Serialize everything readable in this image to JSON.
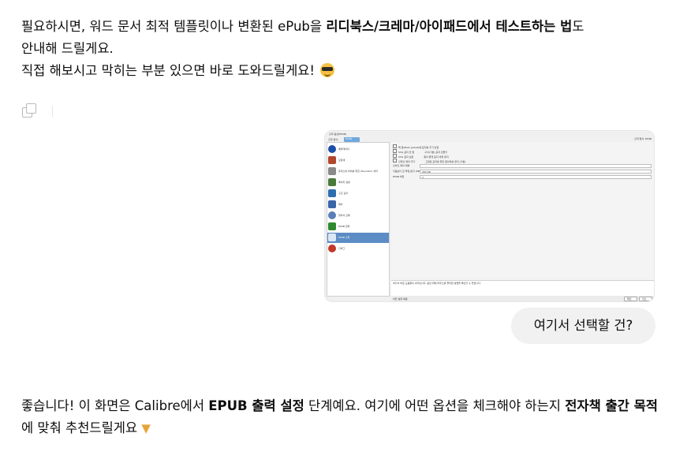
{
  "assistant_message_1": {
    "seg1": "필요하시면, 워드 문서 최적 템플릿이나 변환된 ePub을 ",
    "seg2_bold": "리디북스/크레마/아이패드에서 테스트하는 법",
    "seg3": "도",
    "line2": "안내해 드릴게요.",
    "line3": "직접 해보시고 막히는 부분 있으면 바로 도와드릴게요! ",
    "emoji": "smiling-face-with-sunglasses"
  },
  "actions": {
    "copy_icon": "copy-icon"
  },
  "user_message": {
    "image": {
      "window_title": "출력 옵션(EPUB)",
      "tabs": [
        "출력 형식:",
        "EPUB"
      ],
      "format_label": "출력 형식: EPUB",
      "sidebar_items": [
        {
          "label": "메타데이터",
          "icon": "info-icon",
          "color": "#1b4fa8"
        },
        {
          "label": "모양새",
          "icon": "brush-icon",
          "color": "#b3472b"
        },
        {
          "label": "휴리스틱 처리를 위한 (Heuristic) 처리",
          "icon": "document-icon",
          "color": "#6d6d6d"
        },
        {
          "label": "페이지 설정",
          "icon": "tools-icon",
          "color": "#4a7a3a"
        },
        {
          "label": "구조 감지",
          "icon": "list-icon",
          "color": "#2f6fb0"
        },
        {
          "label": "목차",
          "icon": "toc-icon",
          "color": "#3a66a8"
        },
        {
          "label": "찾아서 교체",
          "icon": "magnifier-icon",
          "color": "#5a7fb5"
        },
        {
          "label": "EPUB 입력",
          "icon": "arrow-right-icon",
          "color": "#2f8a2f"
        },
        {
          "label": "EPUB 출력",
          "icon": "epub-icon",
          "color": "#5b8cc5"
        },
        {
          "label": "디버그",
          "icon": "bug-icon",
          "color": "#c0392b"
        }
      ],
      "options": [
        "책 앞(Book Jacket)에 표지를 추가 안함",
        "SVG 표지 안 함",
        "SVG 표지 보존",
        "인라인 목차 추가"
      ],
      "option_hints": [
        "구식(기본) 표지 만들기",
        "종이 형태 표지 비율 유지",
        "목차 마지막에 추가",
        "고정된 표지를 위한 종횡비를 유지 (기본)"
      ],
      "fields": [
        {
          "label": "인라인 목차 제목",
          "value": ""
        },
        {
          "label": "다음보다 큰 파일 분할 (KB)",
          "value": "260 KB"
        },
        {
          "label": "EPUB 버전",
          "value": "2"
        }
      ],
      "description": "여기서 바로 도움말이 나타납니다. 옵션 위에 마우스를 올리면 설명을 확인할 수 있습니다.",
      "footer_left": "이전 설정 복원",
      "ok_label": "확인",
      "cancel_label": "취소"
    },
    "text": "여기서 선택할 건?"
  },
  "assistant_message_2": {
    "seg1": "좋습니다! 이 화면은 Calibre에서 ",
    "seg2_bold": "EPUB 출력 설정",
    "seg3": " 단계예요. 여기에 어떤 옵션을 체크해야 하는지 ",
    "seg4_bold": "전자책 출간 목적",
    "seg5": "에 맞춰 추천드릴게요 ",
    "emoji": "backhand-index-pointing-down"
  }
}
